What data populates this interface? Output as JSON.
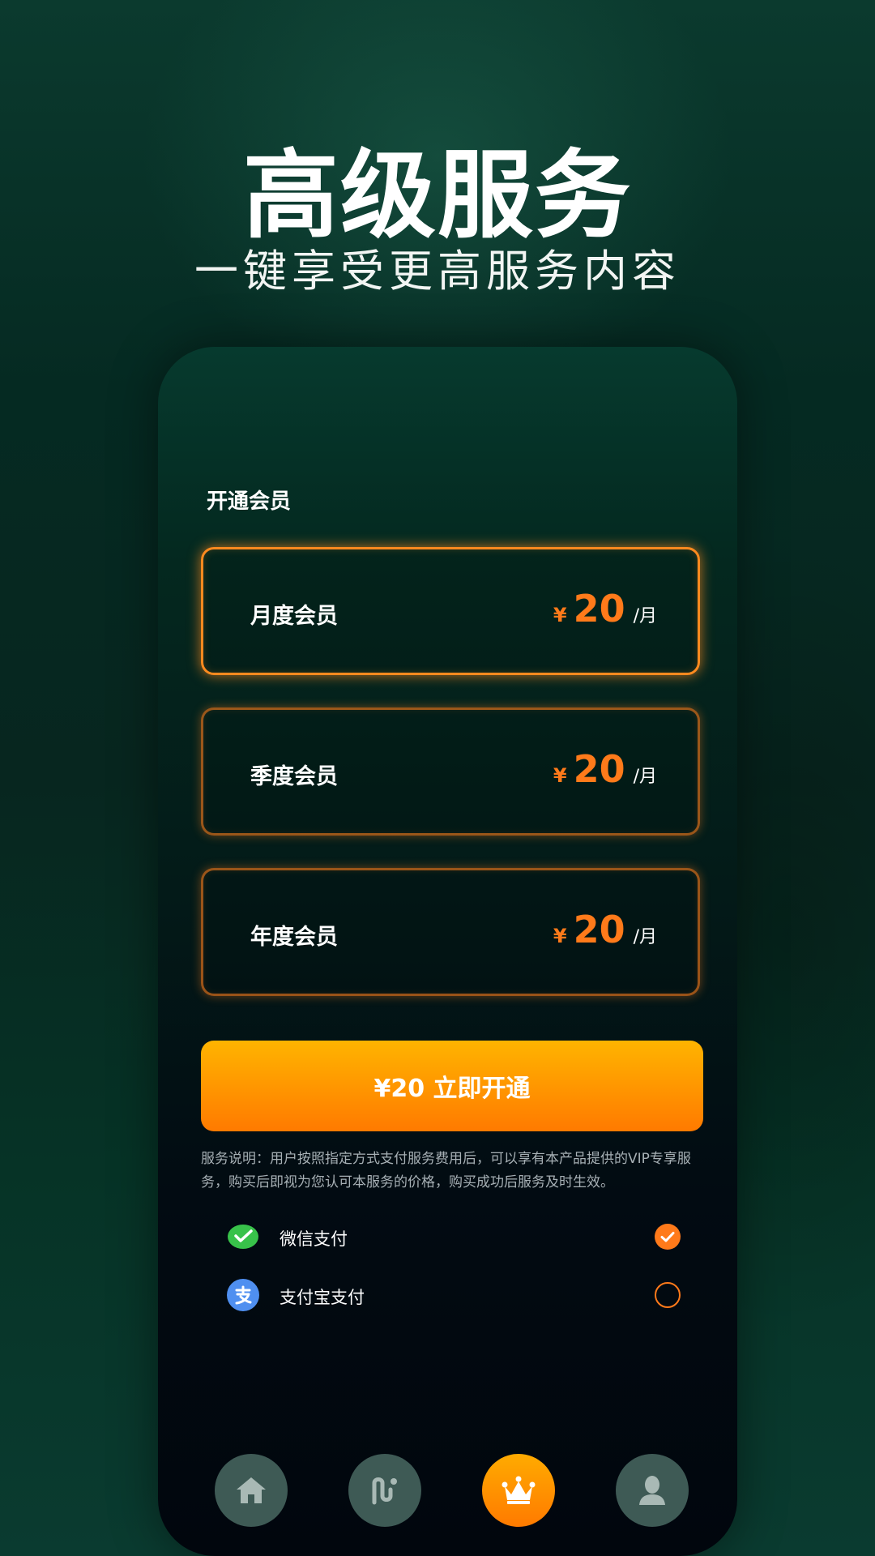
{
  "hero": {
    "title": "高级服务",
    "subtitle": "一键享受更高服务内容"
  },
  "membership": {
    "section_label": "开通会员",
    "plans": [
      {
        "name": "月度会员",
        "currency": "¥",
        "amount": "20",
        "unit": "/月",
        "selected": true
      },
      {
        "name": "季度会员",
        "currency": "¥",
        "amount": "20",
        "unit": "/月",
        "selected": false
      },
      {
        "name": "年度会员",
        "currency": "¥",
        "amount": "20",
        "unit": "/月",
        "selected": false
      }
    ],
    "cta_label": "¥20 立即开通",
    "service_note": "服务说明：用户按照指定方式支付服务费用后，可以享有本产品提供的VIP专享服务，购买后即视为您认可本服务的价格，购买成功后服务及时生效。"
  },
  "payment": {
    "methods": [
      {
        "label": "微信支付",
        "icon": "wechat-pay-icon",
        "checked": true
      },
      {
        "label": "支付宝支付",
        "icon": "alipay-icon",
        "checked": false
      }
    ]
  },
  "tabbar": {
    "tabs": [
      {
        "icon": "home-icon",
        "active": false
      },
      {
        "icon": "route-icon",
        "active": false
      },
      {
        "icon": "crown-icon",
        "active": true
      },
      {
        "icon": "profile-icon",
        "active": false
      }
    ]
  },
  "colors": {
    "accent": "#ff7a1a",
    "cta_top": "#ffb400",
    "cta_bottom": "#ff7a00",
    "tab_inactive": "#3e5a55",
    "wechat_green": "#38c24a",
    "alipay_blue": "#4f8ff0"
  }
}
